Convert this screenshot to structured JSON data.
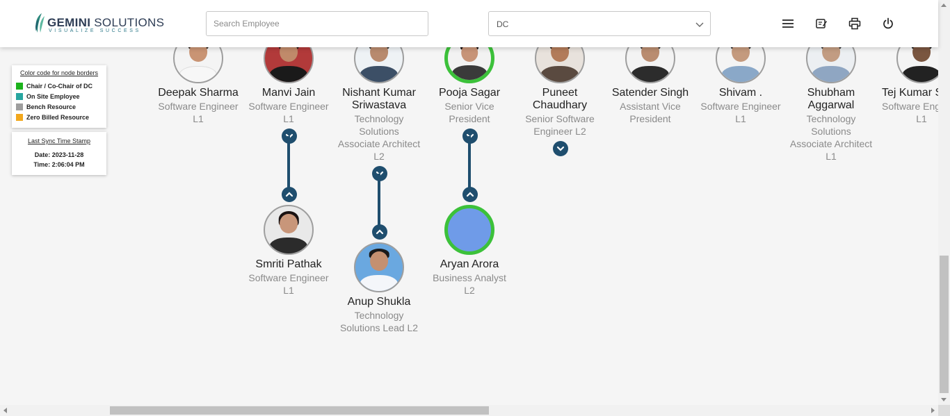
{
  "header": {
    "logo_main": "GEMINI",
    "logo_second": "SOLUTIONS",
    "logo_tagline": "VISUALIZE SUCCESS",
    "search_placeholder": "Search Employee",
    "department_value": "DC",
    "icons": [
      "menu-icon",
      "edit-note-icon",
      "print-icon",
      "power-icon"
    ]
  },
  "legend": {
    "title": "Color code for node borders",
    "items": [
      {
        "label": "Chair / Co-Chair of DC",
        "color": "#1db31d"
      },
      {
        "label": "On Site Employee",
        "color": "#27a6a0"
      },
      {
        "label": "Bench Resource",
        "color": "#9e9e9e"
      },
      {
        "label": "Zero Billed Resource",
        "color": "#f2a81d"
      }
    ]
  },
  "sync": {
    "title": "Last Sync Time Stamp",
    "date": "Date: 2023-11-28",
    "time": "Time: 2:06:04 PM"
  },
  "employees_row1": [
    {
      "name": "Deepak Sharma",
      "role": [
        "Software Engineer",
        "L1"
      ]
    },
    {
      "name": "Manvi Jain",
      "role": [
        "Software Engineer",
        "L1"
      ]
    },
    {
      "name": [
        "Nishant Kumar",
        "Sriwastava"
      ],
      "role": [
        "Technology",
        "Solutions",
        "Associate Architect",
        "L2"
      ]
    },
    {
      "name": "Pooja Sagar",
      "role": [
        "Senior Vice",
        "President"
      ]
    },
    {
      "name": [
        "Puneet",
        "Chaudhary"
      ],
      "role": [
        "Senior Software",
        "Engineer L2"
      ]
    },
    {
      "name": "Satender Singh",
      "role": [
        "Assistant Vice",
        "President"
      ]
    },
    {
      "name": "Shivam .",
      "role": [
        "Software Engineer",
        "L1"
      ]
    },
    {
      "name": [
        "Shubham",
        "Aggarwal"
      ],
      "role": [
        "Technology",
        "Solutions",
        "Associate Architect",
        "L1"
      ]
    },
    {
      "name": "Tej Kumar S",
      "role": [
        "Software Eng",
        "L1"
      ]
    }
  ],
  "employees_row2": [
    {
      "name": "Smriti Pathak",
      "role": [
        "Software Engineer",
        "L1"
      ]
    },
    {
      "name": "Anup Shukla",
      "role": [
        "Technology",
        "Solutions Lead L2"
      ]
    },
    {
      "name": "Aryan Arora",
      "role": [
        "Business Analyst",
        "L2"
      ]
    }
  ],
  "colors": {
    "connector": "#1f4e6e",
    "chair_border": "#3cc13a",
    "bench_border": "#9e9e9e"
  }
}
